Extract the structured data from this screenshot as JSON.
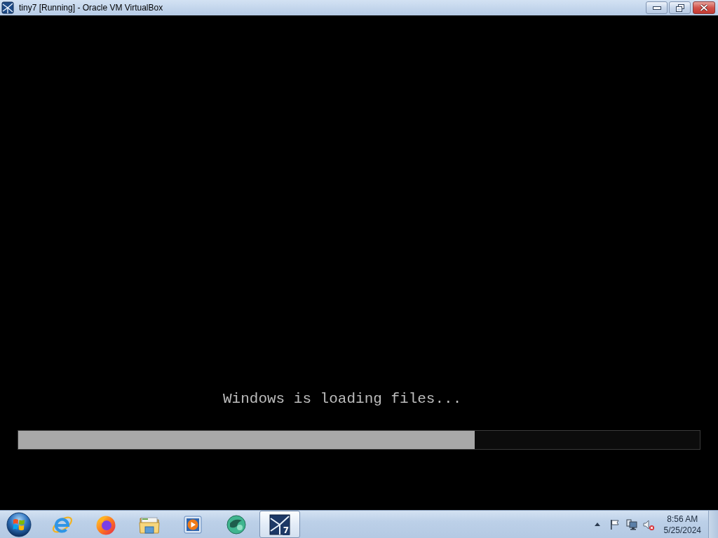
{
  "window": {
    "title": "tiny7 [Running] - Oracle VM VirtualBox"
  },
  "screen": {
    "message": "Windows is loading files...",
    "progress": {
      "level": 0.67
    }
  },
  "taskbar": {
    "items": [
      {
        "kind": "ie",
        "selected": false
      },
      {
        "kind": "firefox",
        "selected": false
      },
      {
        "kind": "explorer",
        "selected": false
      },
      {
        "kind": "media",
        "selected": false
      },
      {
        "kind": "orb",
        "selected": false
      },
      {
        "kind": "vm",
        "selected": true,
        "badge": "7"
      }
    ]
  },
  "tray": {
    "muted": true,
    "time": "8:56 AM",
    "date": "5/25/2024"
  }
}
